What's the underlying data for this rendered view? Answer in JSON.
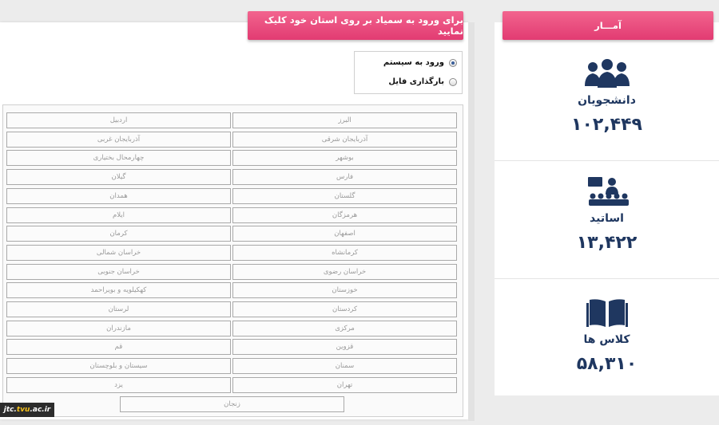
{
  "main": {
    "header": "برای ورود به سمیاد بر روی استان خود کلیک نمایید",
    "radio_login": "ورود به سیستم",
    "radio_upload": "بارگذاری فایل",
    "provinces_right": [
      "البرز",
      "آذربایجان شرقی",
      "بوشهر",
      "فارس",
      "گلستان",
      "هرمزگان",
      "اصفهان",
      "کرمانشاه",
      "خراسان رضوی",
      "خوزستان",
      "کردستان",
      "مرکزی",
      "قزوین",
      "سمنان",
      "تهران"
    ],
    "provinces_left": [
      "اردبیل",
      "آذربایجان غربی",
      "چهارمحال بختیاری",
      "گیلان",
      "همدان",
      "ایلام",
      "کرمان",
      "خراسان شمالی",
      "خراسان جنوبی",
      "کهکیلویه و بویراحمد",
      "لرستان",
      "مازندران",
      "قم",
      "سیستان و بلوچستان",
      "یزد"
    ],
    "province_last": "زنجان"
  },
  "stats": {
    "header": "آمـــار",
    "students_label": "دانشجویان",
    "students_value": "۱۰۲,۴۴۹",
    "teachers_label": "اساتید",
    "teachers_value": "۱۳,۴۲۲",
    "classes_label": "کلاس ها",
    "classes_value": "۵۸,۳۱۰"
  },
  "watermark": {
    "prefix": "jtc.",
    "accent": "tvu",
    "suffix": ".ac.ir"
  },
  "colors": {
    "accent": "#e23b72",
    "stat_text": "#1f3760"
  }
}
